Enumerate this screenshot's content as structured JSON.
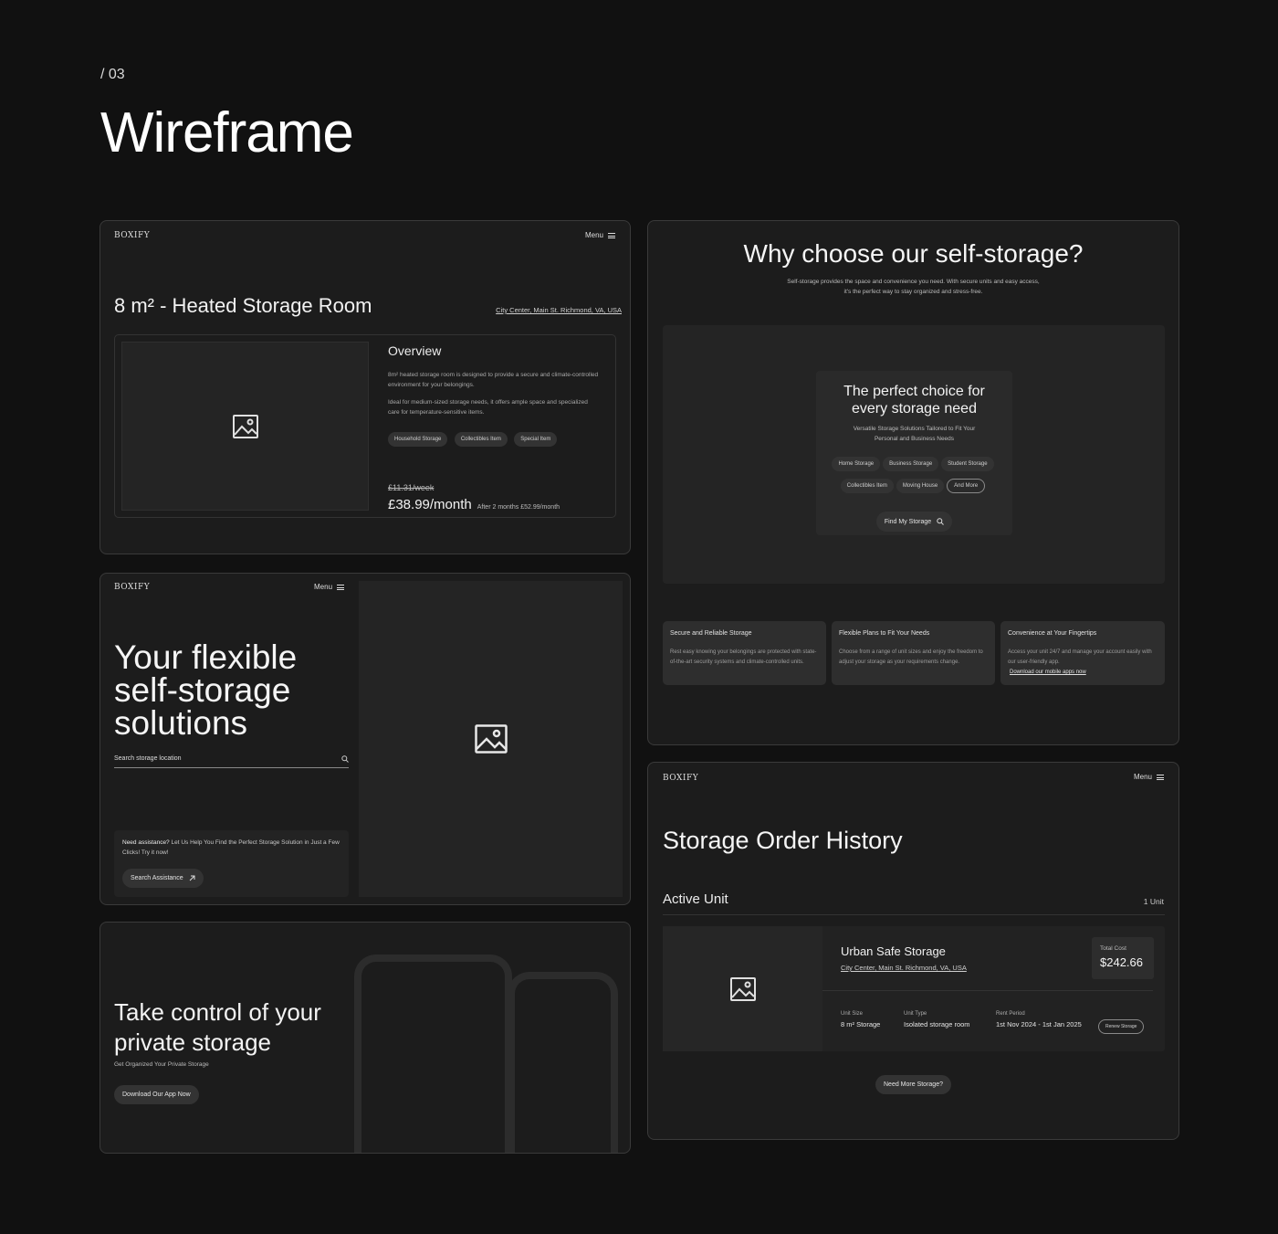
{
  "header": {
    "section_number": "/ 03",
    "title": "Wireframe"
  },
  "card1": {
    "brand": "BOXIFY",
    "menu_label": "Menu",
    "room_title": "8 m² - Heated Storage Room",
    "location": "City Center, Main St. Richmond, VA, USA",
    "overview_title": "Overview",
    "overview_p1": "8m² heated storage room is designed to provide a secure and climate-controlled environment for your belongings.",
    "overview_p2": "Ideal for medium-sized storage needs, it offers ample space and specialized care for temperature-sensitive items.",
    "tags": [
      "Household Storage",
      "Collectibles Item",
      "Special Item"
    ],
    "old_price": "£11.31/week",
    "price": "£38.99/month",
    "price_note": "After 2 months £52.99/month",
    "image_icon": "image-icon"
  },
  "card2": {
    "brand": "BOXIFY",
    "menu_label": "Menu",
    "hero_line1": "Your flexible",
    "hero_line2": "self-storage",
    "hero_line3": "solutions",
    "search_placeholder": "Search storage location",
    "assist_bold": "Need assistance?",
    "assist_text": "Let Us Help You Find the Perfect Storage Solution in Just a Few Clicks! Try it now!",
    "assist_button": "Search Assistance"
  },
  "card3": {
    "title_line1": "Take control of your",
    "title_line2": "private storage",
    "subtitle": "Get Organized Your Private Storage",
    "button": "Download Our App Now"
  },
  "card4": {
    "title": "Why choose our self-storage?",
    "subtitle_line1": "Self-storage provides the space and convenience you need. With secure units and easy access,",
    "subtitle_line2": "it's the perfect way to stay organized and stress-free.",
    "panel_title_line1": "The perfect choice for",
    "panel_title_line2": "every storage need",
    "panel_sub_line1": "Versatile Storage Solutions Tailored to Fit Your",
    "panel_sub_line2": "Personal and Business Needs",
    "chips_row1": [
      "Home Storage",
      "Business Storage",
      "Student Storage"
    ],
    "chips_row2": [
      "Collectibles Item",
      "Moving House"
    ],
    "chip_more": "And More",
    "find_button": "Find My Storage",
    "features": [
      {
        "title": "Secure and Reliable Storage",
        "text": "Rest easy knowing your belongings are protected with state-of-the-art security systems and climate-controlled units.",
        "link": ""
      },
      {
        "title": "Flexible Plans to Fit Your Needs",
        "text": "Choose from a range of unit sizes and enjoy the freedom to adjust your storage as your requirements change.",
        "link": ""
      },
      {
        "title": "Convenience at Your Fingertips",
        "text": "Access your unit 24/7 and manage your account easily with our user-friendly app.",
        "link": "Download our mobile apps now"
      }
    ]
  },
  "card5": {
    "brand": "BOXIFY",
    "menu_label": "Menu",
    "title": "Storage Order History",
    "active_label": "Active Unit",
    "unit_count": "1 Unit",
    "storage_name": "Urban Safe Storage",
    "location": "City Center, Main St. Richmond, VA, USA",
    "total_cost_label": "Total Cost",
    "total_cost": "$242.66",
    "unit_size_label": "Unit Size",
    "unit_size": "8 m² Storage",
    "unit_type_label": "Unit Type",
    "unit_type": "Isolated storage room",
    "rent_period_label": "Rent Period",
    "rent_period": "1st Nov 2024 - 1st Jan 2025",
    "renew_button": "Renew Storage",
    "more_button": "Need More Storage?"
  }
}
